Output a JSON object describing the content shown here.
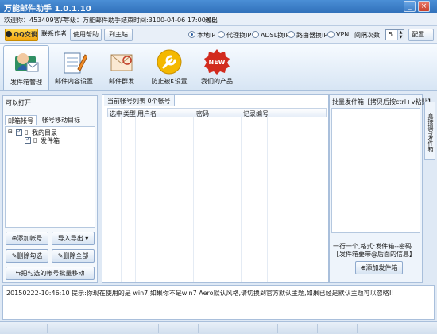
{
  "window": {
    "title": "万能邮件助手 1.0.1.10",
    "min_label": "_",
    "close_label": "×"
  },
  "info": {
    "welcome": "欢迎你：453409客户",
    "level": "等级：万能邮件助手",
    "end_time": "结束时间:3100-04-06 17:00:00",
    "logout": "退出"
  },
  "toolbar": {
    "qq_label": "QQ交谈",
    "contact_label": "联系作者",
    "help_label": "使用帮助",
    "site_label": "到主站",
    "ip_options": [
      {
        "label": "本地IP",
        "selected": true
      },
      {
        "label": "代理换IP",
        "selected": false
      },
      {
        "label": "ADSL换IP",
        "selected": false
      },
      {
        "label": "路由器换IP",
        "selected": false
      },
      {
        "label": "VPN",
        "selected": false
      }
    ],
    "interval_label": "间隔次数",
    "interval_value": "5",
    "config_label": "配置..."
  },
  "nav": [
    {
      "label": "发件箱管理",
      "icon": "mailbox-manage-icon",
      "active": true
    },
    {
      "label": "邮件内容设置",
      "icon": "notepad-pencil-icon",
      "active": false
    },
    {
      "label": "邮件群发",
      "icon": "stamp-envelope-icon",
      "active": false
    },
    {
      "label": "防止被K设置",
      "icon": "wrench-gold-icon",
      "active": false
    },
    {
      "label": "我们的产品",
      "icon": "new-badge-icon",
      "active": false,
      "badge": "NEW"
    }
  ],
  "left": {
    "title": "可以打开",
    "tabs": [
      "邮箱帐号",
      "帐号移动目标"
    ],
    "tree": {
      "root": "我的目录",
      "child": "发件箱",
      "root_checked": true,
      "child_checked": true
    },
    "buttons": {
      "add": "添加帐号",
      "import_export": "导入导出",
      "delete_checked": "删除勾选",
      "delete_all": "删除全部",
      "move_checked": "把勾选的帐号批量移动"
    }
  },
  "middle": {
    "tab": "当前帐号列表 0个帐号",
    "columns": [
      "选中",
      "类型",
      "用户名",
      "密码",
      "记录编号"
    ]
  },
  "right": {
    "title": "批量发件箱【拷贝后按ctrl+v粘贴】",
    "hint": "一行一个,格式:发件箱--密码【发件箱要带@后面的信息】",
    "add_button": "添加发件箱",
    "side_tab": "直接填写发件箱"
  },
  "log": {
    "message": "20150222-10:46:10  提示:你现在使用的是 win7,如果你不是win7 Aero默认风格,请切换到官方默认主题,如果已经是默认主题可以忽略!!"
  },
  "colors": {
    "titlebar": "#3a7dc9",
    "accent": "#2a5ea2",
    "new_badge": "#d22b1e",
    "wrench": "#f4b800"
  }
}
